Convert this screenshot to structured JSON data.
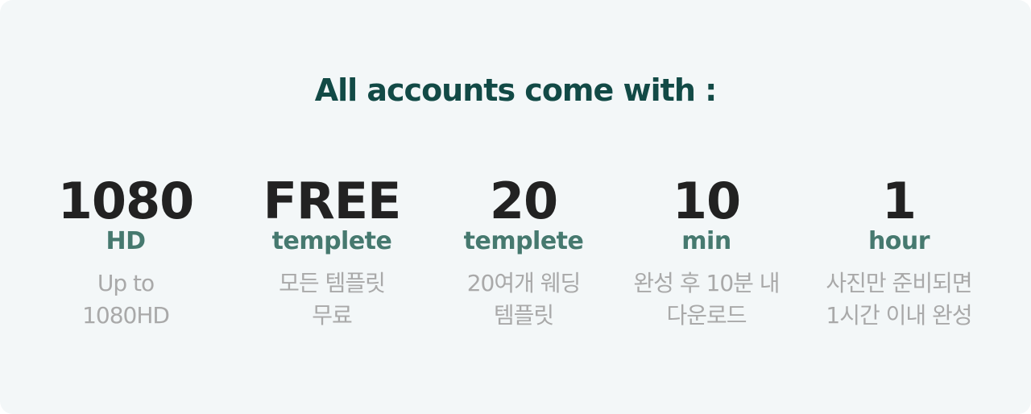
{
  "heading": "All accounts come with :",
  "features": [
    {
      "value": "1080",
      "unit": "HD",
      "desc_line1": "Up to",
      "desc_line2": "1080HD"
    },
    {
      "value": "FREE",
      "unit": "templete",
      "desc_line1": "모든 템플릿",
      "desc_line2": "무료"
    },
    {
      "value": "20",
      "unit": "templete",
      "desc_line1": "20여개 웨딩",
      "desc_line2": "템플릿"
    },
    {
      "value": "10",
      "unit": "min",
      "desc_line1": "완성 후 10분 내",
      "desc_line2": "다운로드"
    },
    {
      "value": "1",
      "unit": "hour",
      "desc_line1": "사진만 준비되면",
      "desc_line2": "1시간 이내 완성"
    }
  ],
  "colors": {
    "background": "#f3f7f8",
    "heading": "#124a46",
    "value": "#222222",
    "unit": "#46796f",
    "description": "#a9a9a9"
  }
}
